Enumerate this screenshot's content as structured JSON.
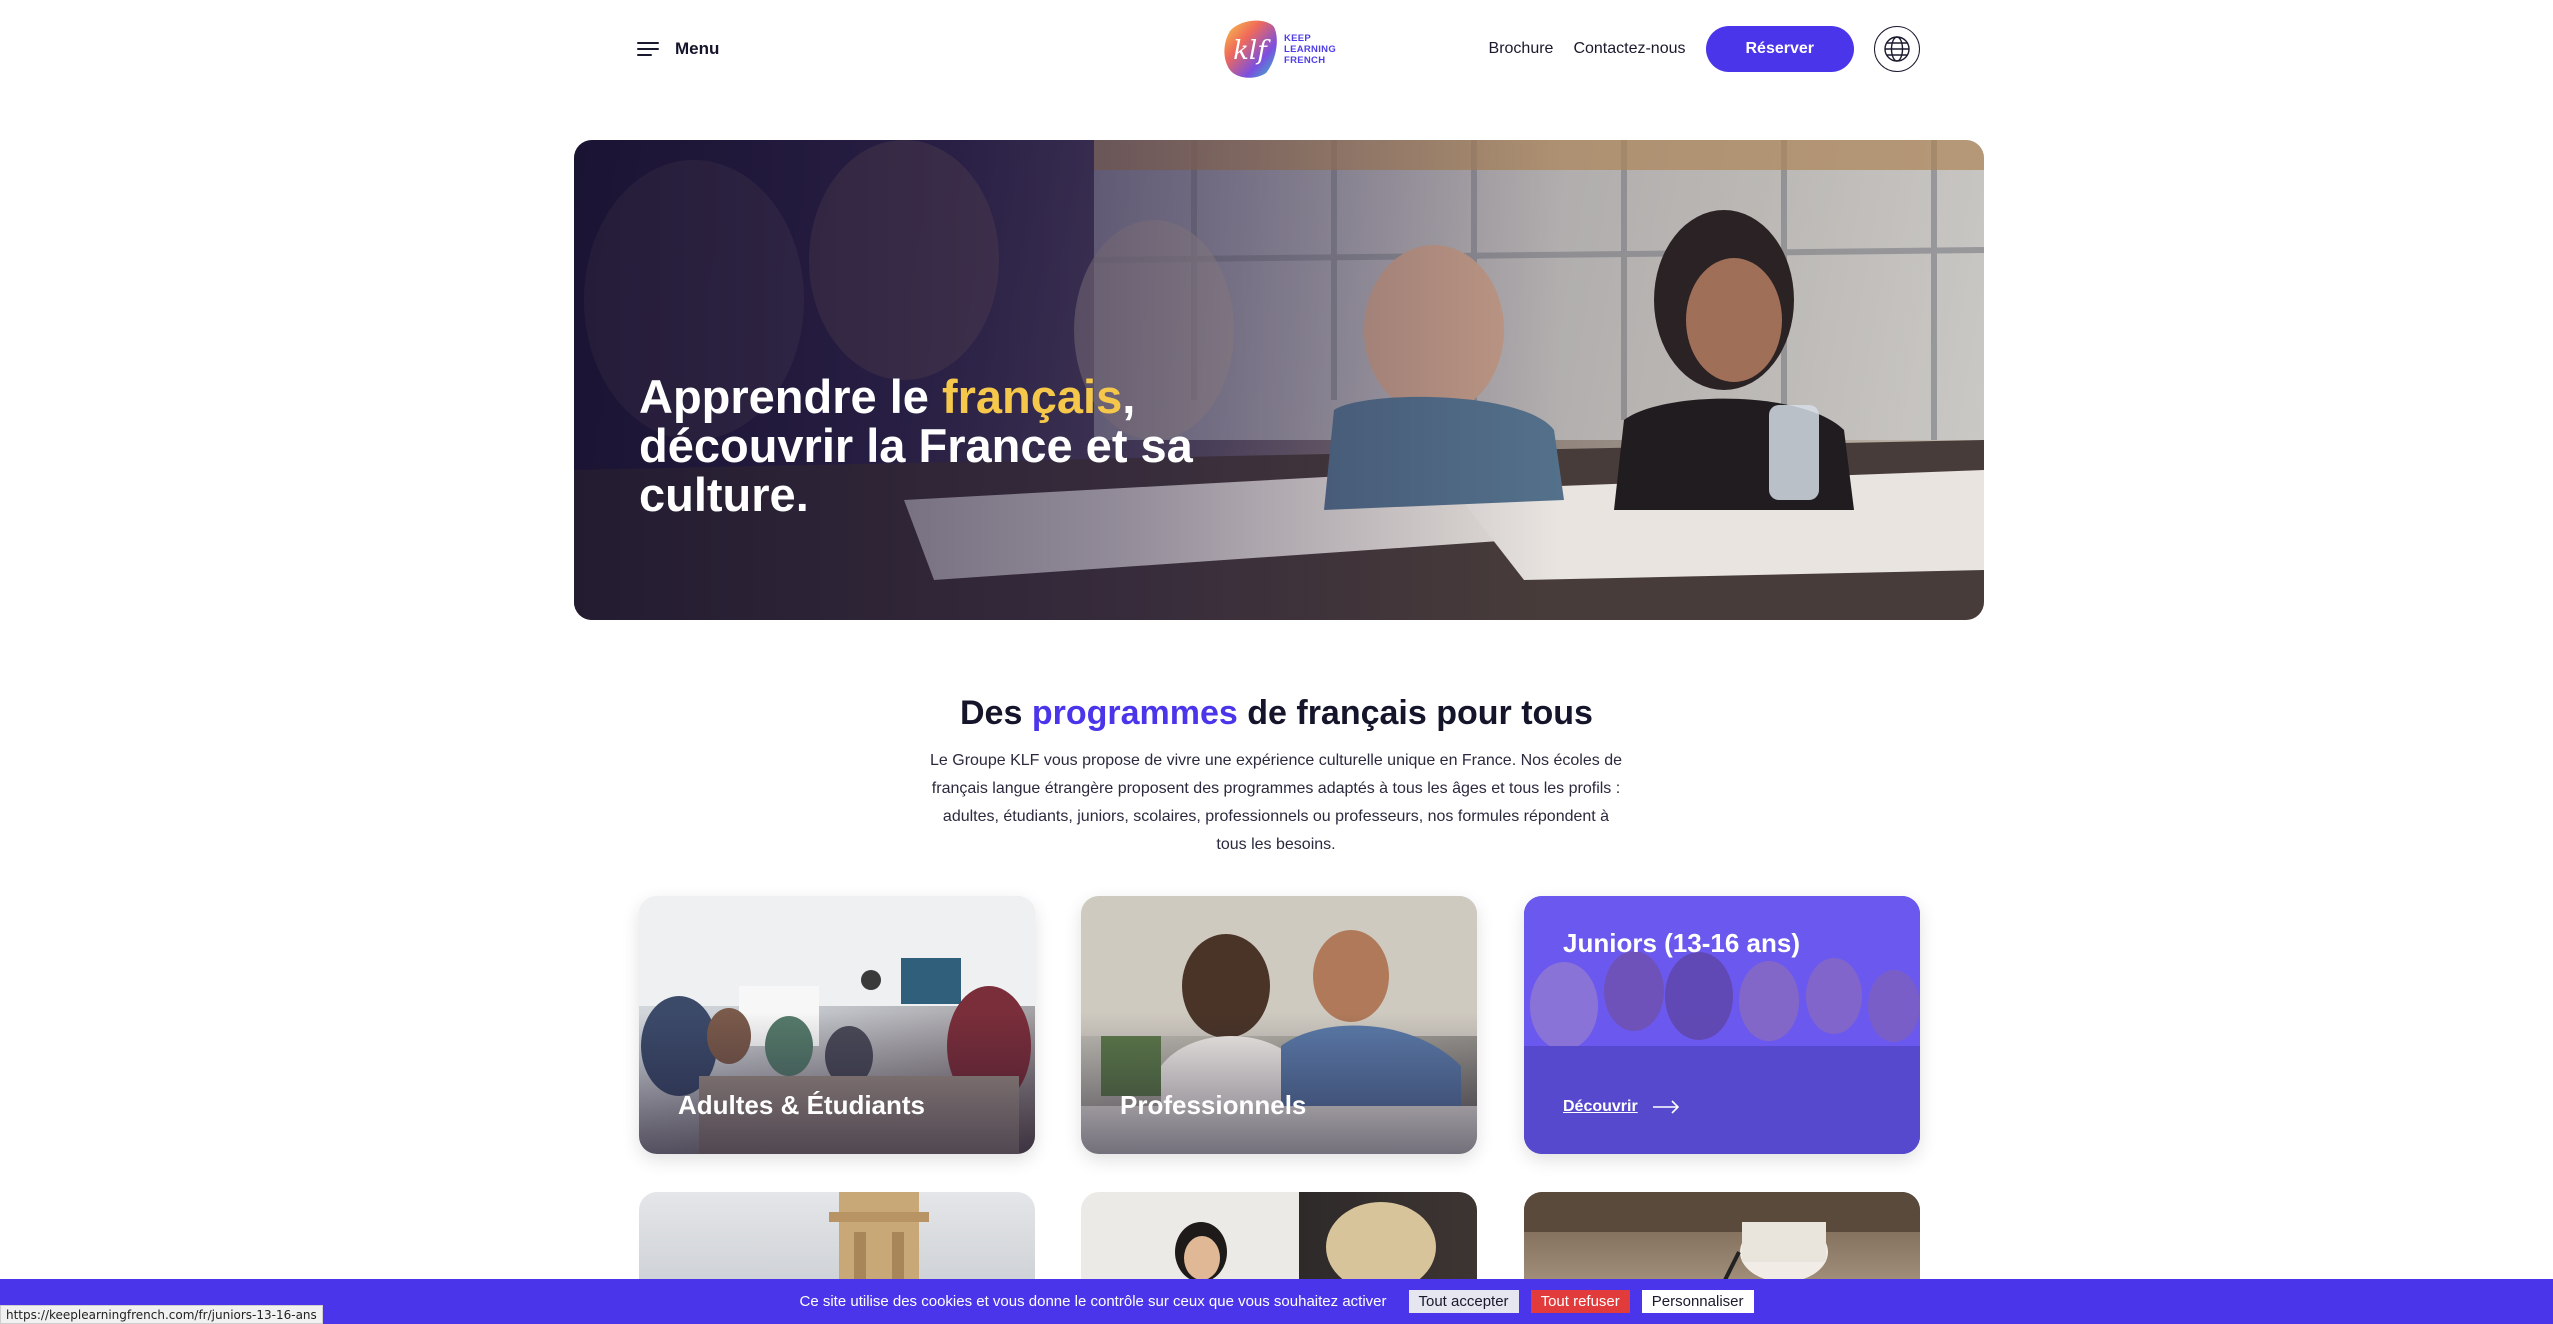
{
  "header": {
    "menu_label": "Menu",
    "logo_lines": [
      "KEEP",
      "LEARNING",
      "FRENCH"
    ],
    "logo_mark": "klf",
    "nav": {
      "brochure": "Brochure",
      "contact": "Contactez-nous",
      "reserve": "Réserver"
    },
    "globe_icon": "globe-icon"
  },
  "hero": {
    "title_before": "Apprendre le ",
    "title_highlight": "français",
    "title_after": ", découvrir la France et sa culture."
  },
  "programs": {
    "title_before": "Des ",
    "title_highlight": "programmes",
    "title_after": " de français pour tous",
    "description": "Le Groupe KLF vous propose de vivre une expérience culturelle unique en France. Nos écoles de français langue étrangère proposent des programmes adaptés à tous les âges et tous les profils : adultes, étudiants, juniors, scolaires, professionnels ou professeurs, nos formules répondent à tous les besoins.",
    "cards": [
      {
        "label": "Adultes & Étudiants"
      },
      {
        "label": "Professionnels"
      },
      {
        "label": "Juniors (13-16 ans)",
        "cta": "Découvrir"
      }
    ]
  },
  "cookie": {
    "text": "Ce site utilise des cookies et vous donne le contrôle sur ceux que vous souhaitez activer",
    "accept": "Tout accepter",
    "refuse": "Tout refuser",
    "customize": "Personnaliser"
  },
  "status_url": "https://keeplearningfrench.com/fr/juniors-13-16-ans",
  "colors": {
    "accent": "#4b35ea",
    "highlight": "#f5c84b",
    "refuse": "#e23b3b"
  }
}
